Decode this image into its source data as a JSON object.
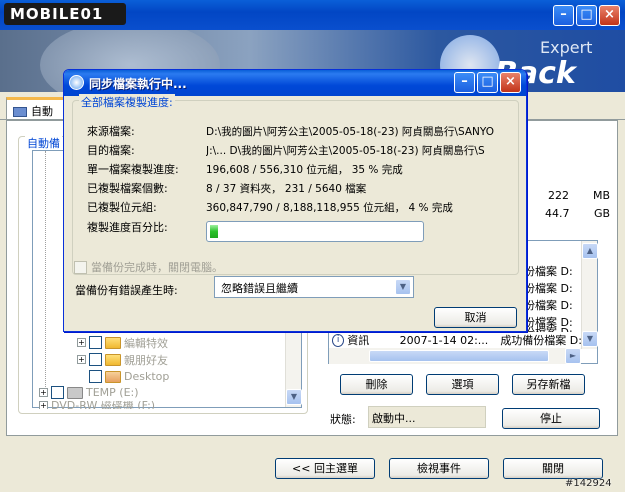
{
  "watermark_logo": "MOBILE01",
  "watermark_id": "#142924",
  "banner_text": "Expert",
  "banner_logo": "Back",
  "tab_label": "自動備",
  "left_group_label": "自動備",
  "tree": [
    {
      "label": "編輯特效",
      "expand": "+"
    },
    {
      "label": "親朋好友",
      "expand": "+"
    },
    {
      "label": "Desktop",
      "expand": ""
    },
    {
      "label": "TEMP (E:)",
      "expand": "+"
    },
    {
      "label": "DVD-RW 磁碟機 (F:)",
      "expand": "+"
    }
  ],
  "sizes": [
    {
      "value": "222",
      "unit": "MB"
    },
    {
      "value": "44.7",
      "unit": "GB"
    }
  ],
  "log_rows": [
    {
      "msg": "份檔案 D:"
    },
    {
      "msg": "份檔案 D:"
    },
    {
      "msg": "份檔案 D:"
    },
    {
      "msg": "份檔案 D:"
    },
    {
      "msg": "份檔案 D:"
    },
    {
      "type": "資訊",
      "time": "2007-1-14 02:...",
      "msg": "成功備份檔案 D:"
    }
  ],
  "buttons": {
    "delete": "刪除",
    "options": "選項",
    "save_as": "另存新檔",
    "stop": "停止",
    "back_main": "<< 回主選單",
    "view_events": "檢視事件",
    "close": "關閉"
  },
  "status": {
    "label": "狀態:",
    "value": "啟動中..."
  },
  "dialog": {
    "title": "同步檔案執行中...",
    "group_title": "全部檔案複製進度:",
    "rows": [
      {
        "label": "來源檔案:",
        "value": "D:\\我的圖片\\阿芳公主\\2005-05-18(-23) 阿貞關島行\\SANYO"
      },
      {
        "label": "目的檔案:",
        "value": "J:\\... D\\我的圖片\\阿芳公主\\2005-05-18(-23) 阿貞關島行\\S"
      },
      {
        "label": "單一檔案複製進度:",
        "value": "196,608 / 556,310 位元組， 35 % 完成"
      },
      {
        "label": "已複製檔案個數:",
        "value": "8 / 37 資料夾， 231 / 5640 檔案"
      },
      {
        "label": "已複製位元組:",
        "value": "360,847,790 / 8,188,118,955 位元組， 4 % 完成"
      }
    ],
    "percent_label": "複製進度百分比:",
    "progress_fraction": 0.04,
    "shutdown_label": "當備份完成時，關閉電腦。",
    "error_label": "當備份有錯誤產生時:",
    "error_option": "忽略錯誤且繼續",
    "cancel": "取消"
  }
}
